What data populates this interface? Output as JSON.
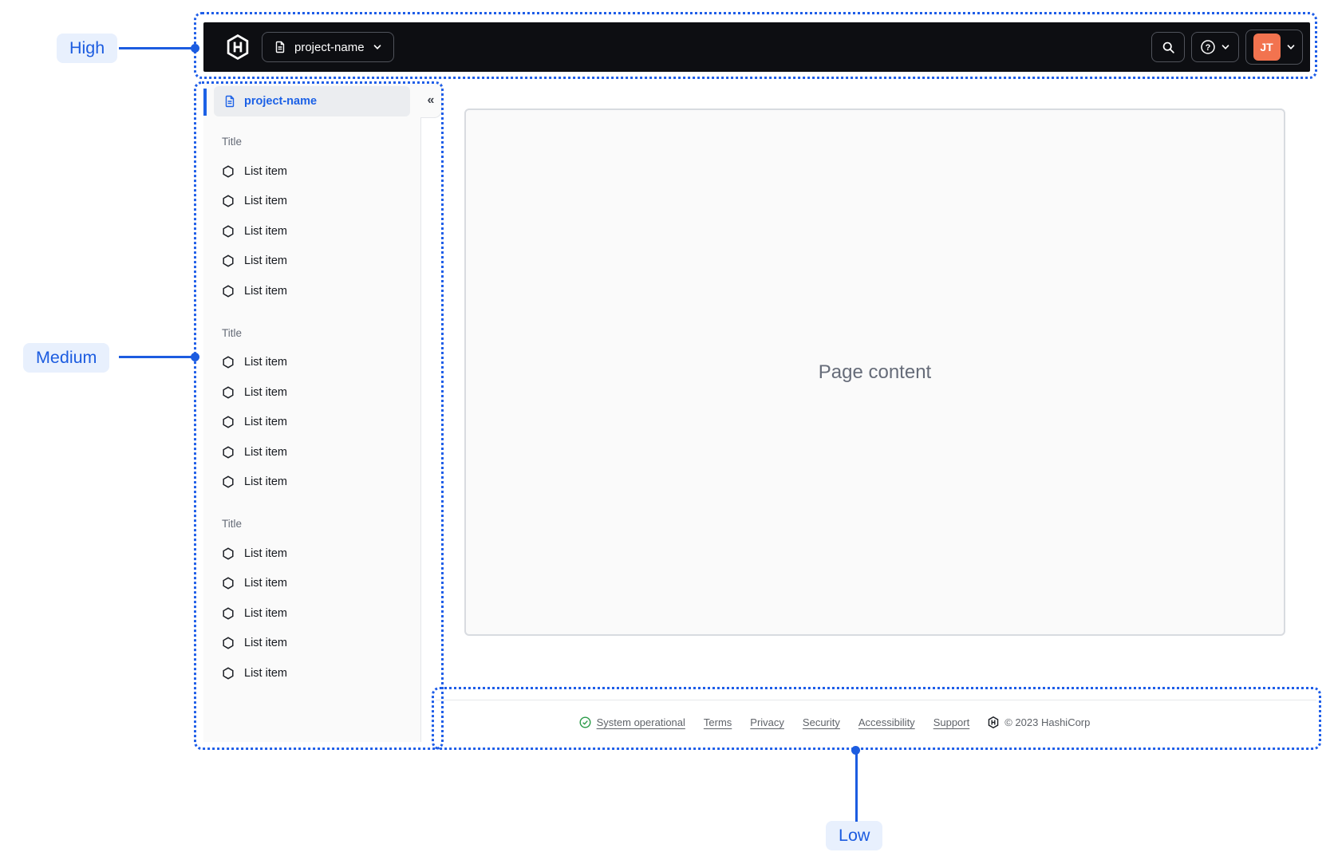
{
  "annotations": {
    "high": {
      "label": "High"
    },
    "medium": {
      "label": "Medium"
    },
    "low": {
      "label": "Low"
    }
  },
  "navbar": {
    "logo_icon": "hashicorp-logo",
    "project_switcher": {
      "icon": "file-text-icon",
      "label": "project-name",
      "chevron": "chevron-down-icon"
    },
    "search_icon": "search-icon",
    "help_icon": "help-icon",
    "user": {
      "initials": "JT"
    }
  },
  "sidebar": {
    "header": {
      "icon": "file-text-icon",
      "label": "project-name",
      "collapse_glyph": "«"
    },
    "sections": [
      {
        "title": "Title",
        "items": [
          "List item",
          "List item",
          "List item",
          "List item",
          "List item"
        ]
      },
      {
        "title": "Title",
        "items": [
          "List item",
          "List item",
          "List item",
          "List item",
          "List item"
        ]
      },
      {
        "title": "Title",
        "items": [
          "List item",
          "List item",
          "List item",
          "List item",
          "List item"
        ]
      }
    ],
    "item_icon": "hexagon-icon"
  },
  "main": {
    "placeholder": "Page content"
  },
  "footer": {
    "status": {
      "icon": "check-circle-icon",
      "label": "System operational"
    },
    "links": [
      "Terms",
      "Privacy",
      "Security",
      "Accessibility",
      "Support"
    ],
    "logo_icon": "hashicorp-logo",
    "copyright": "© 2023 HashiCorp"
  },
  "colors": {
    "accent_blue": "#1c5ce0",
    "navbar_bg": "#0d0e12",
    "avatar_orange": "#f2734f",
    "status_green": "#2a9b48"
  }
}
